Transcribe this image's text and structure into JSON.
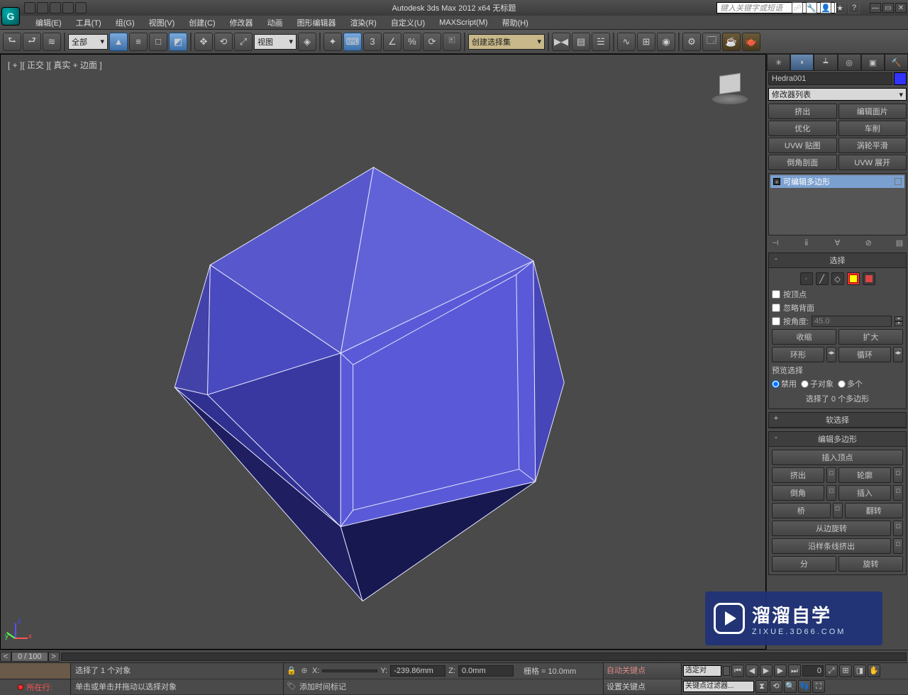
{
  "title": "Autodesk 3ds Max  2012 x64       无标题",
  "search_placeholder": "键入关键字或短语",
  "menu": [
    "编辑(E)",
    "工具(T)",
    "组(G)",
    "视图(V)",
    "创建(C)",
    "修改器",
    "动画",
    "图形编辑器",
    "渲染(R)",
    "自定义(U)",
    "MAXScript(M)",
    "帮助(H)"
  ],
  "toolbar": {
    "filter": "全部",
    "refsys": "视图",
    "selset": "创建选择集"
  },
  "viewport_label": "[ + ][ 正交 ][ 真实 + 边面 ]",
  "timeline_range": "0 / 100",
  "object_name": "Hedra001",
  "mod_list_label": "修改器列表",
  "mod_buttons": [
    "挤出",
    "编辑面片",
    "优化",
    "车削",
    "UVW 贴图",
    "涡轮平滑",
    "倒角剖面",
    "UVW 展开"
  ],
  "stack_item": "可编辑多边形",
  "roll_select": {
    "title": "选择",
    "by_vertex": "按顶点",
    "ignore_back": "忽略背面",
    "by_angle": "按角度:",
    "angle": "45.0",
    "shrink": "收缩",
    "grow": "扩大",
    "ring": "环形",
    "loop": "循环",
    "preview": "预览选择",
    "r1": "禁用",
    "r2": "子对象",
    "r3": "多个",
    "count": "选择了 0 个多边形"
  },
  "roll_soft": "软选择",
  "roll_edit": {
    "title": "编辑多边形",
    "insert_vert": "插入顶点",
    "extrude": "挤出",
    "outline": "轮廓",
    "bevel": "倒角",
    "inset": "插入",
    "bridge": "桥",
    "flip": "翻转",
    "hinge": "从边旋转",
    "extrude_spline": "沿样条线挤出",
    "split": "分",
    "rotate2": "旋转"
  },
  "status": {
    "sel": "选择了 1 个对象",
    "hint": "单击或单击并拖动以选择对象",
    "x": "",
    "y": "-239.86mm",
    "z": "0.0mm",
    "grid": "栅格 = 10.0mm",
    "addtime": "添加时间标记",
    "autokey": "自动关键点",
    "setkey": "设置关键点",
    "selonly": "选定对",
    "keyfilt": "关键点过滤器...",
    "nowat": "所在行:",
    "frame": "0"
  },
  "watermark": {
    "t1": "溜溜自学",
    "t2": "ZIXUE.3D66.COM"
  }
}
